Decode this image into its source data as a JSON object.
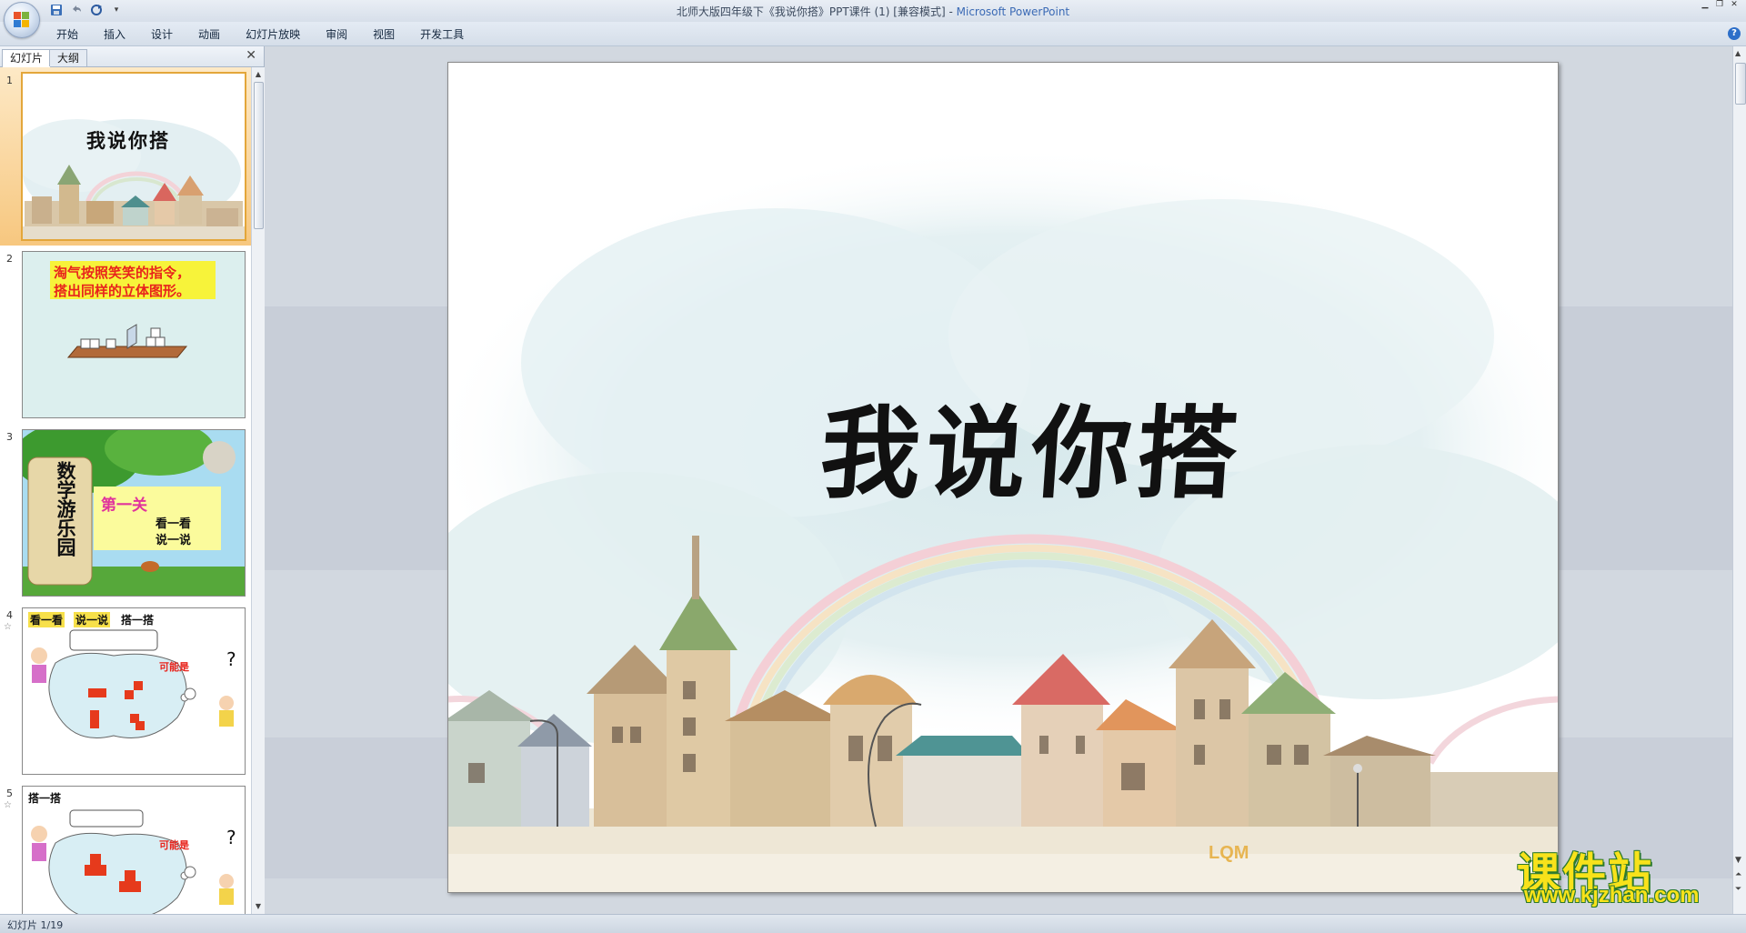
{
  "window": {
    "title": "北师大版四年级下《我说你搭》PPT课件 (1) [兼容模式] - ",
    "app_name": "Microsoft PowerPoint"
  },
  "ribbon": {
    "tabs": [
      "开始",
      "插入",
      "设计",
      "动画",
      "幻灯片放映",
      "审阅",
      "视图",
      "开发工具"
    ]
  },
  "pane": {
    "tab_slides": "幻灯片",
    "tab_outline": "大纲",
    "close": "✕",
    "thumbnails": [
      {
        "number": "1",
        "title": "我说你搭"
      },
      {
        "number": "2",
        "line1": "淘气按照笑笑的指令，",
        "line2": "搭出同样的立体图形。"
      },
      {
        "number": "3",
        "vertical": "数学游乐园",
        "level": "第一关",
        "line1": "看一看",
        "line2": "说一说"
      },
      {
        "number": "4",
        "header1": "看一看",
        "header2": "说一说",
        "header3": "搭一搭",
        "maybe": "可能是",
        "q": "?"
      },
      {
        "number": "5",
        "header1": "搭一搭",
        "maybe": "可能是",
        "q": "?"
      }
    ]
  },
  "slide": {
    "title": "我说你搭",
    "signature": "LQM"
  },
  "status": {
    "slide_counter": "幻灯片 1/19"
  },
  "watermark": {
    "cn": "课件站",
    "url": "www.kjzhan.com"
  },
  "colors": {
    "accent_orange": "#e3a63a",
    "title_blue": "#3b6ab5",
    "watermark_yellow": "#f8e21a"
  }
}
